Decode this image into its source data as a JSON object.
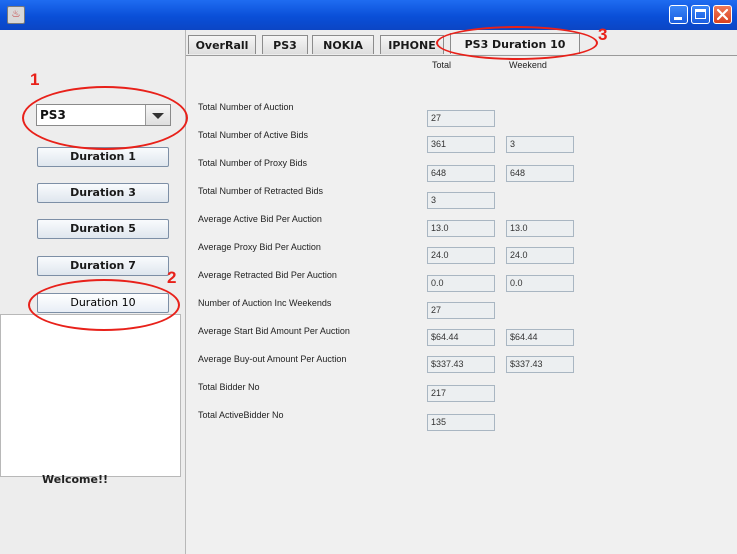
{
  "window": {
    "app_icon_glyph": "♨"
  },
  "sidebar": {
    "product_select": {
      "value": "PS3"
    },
    "buttons": [
      {
        "label": "Duration 1"
      },
      {
        "label": "Duration 3"
      },
      {
        "label": "Duration 5"
      },
      {
        "label": "Duration 7"
      },
      {
        "label": "Duration 10"
      }
    ],
    "welcome_text": "Welcome!!"
  },
  "tabs": [
    {
      "label": "OverRall"
    },
    {
      "label": "PS3"
    },
    {
      "label": "NOKIA"
    },
    {
      "label": "IPHONE"
    },
    {
      "label": "PS3 Duration 10"
    }
  ],
  "stats": {
    "columns": {
      "total": "Total",
      "weekend": "Weekend"
    },
    "rows": [
      {
        "label": "Total Number of Auction",
        "total": "27",
        "weekend": null
      },
      {
        "label": "Total Number of Active Bids",
        "total": "361",
        "weekend": "3"
      },
      {
        "label": "Total Number of Proxy Bids",
        "total": "648",
        "weekend": "648"
      },
      {
        "label": "Total Number of Retracted Bids",
        "total": "3",
        "weekend": null
      },
      {
        "label": "Average Active Bid Per Auction",
        "total": "13.0",
        "weekend": "13.0"
      },
      {
        "label": "Average Proxy Bid Per Auction",
        "total": "24.0",
        "weekend": "24.0"
      },
      {
        "label": "Average Retracted Bid Per Auction",
        "total": "0.0",
        "weekend": "0.0"
      },
      {
        "label": "Number of Auction Inc Weekends",
        "total": "27",
        "weekend": null
      },
      {
        "label": "Average Start Bid Amount Per Auction",
        "total": "$64.44",
        "weekend": "$64.44"
      },
      {
        "label": "Average Buy-out Amount Per Auction",
        "total": "$337.43",
        "weekend": "$337.43"
      },
      {
        "label": "Total Bidder No",
        "total": "217",
        "weekend": null
      },
      {
        "label": "Total ActiveBidder No",
        "total": "135",
        "weekend": null
      }
    ]
  },
  "annotations": [
    "1",
    "2",
    "3"
  ],
  "colors": {
    "annotation": "#e8211a",
    "titlebar": "#0a4fd8"
  }
}
